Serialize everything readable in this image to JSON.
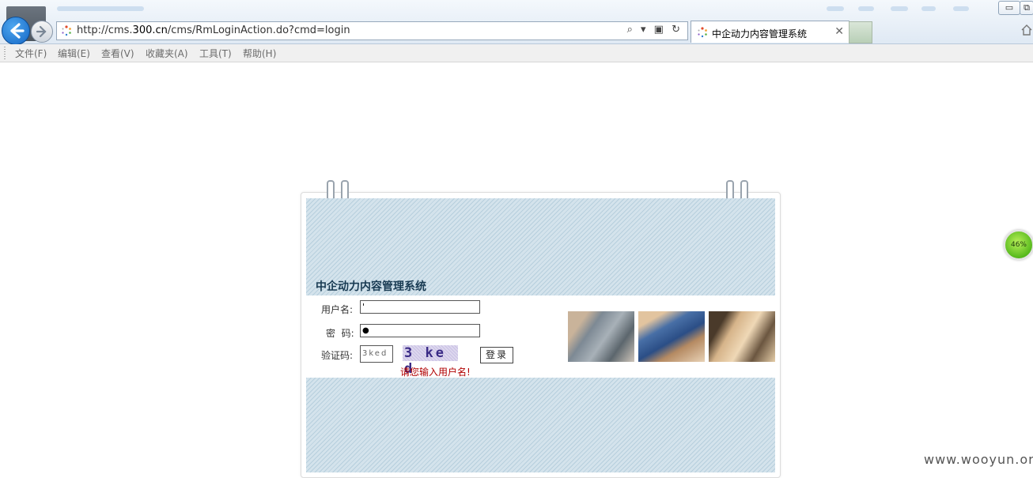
{
  "browser": {
    "url_prefix": "http://cms.",
    "url_domain": "300.cn",
    "url_path": "/cms/RmLoginAction.do?cmd=login",
    "address_controls": "⌕ ▾ ▣ ↻",
    "tab_title": "中企动力内容管理系统",
    "tab_close": "✕",
    "window_min": "▭",
    "window_restore": "⧉"
  },
  "menu": [
    {
      "label": "文件(F)"
    },
    {
      "label": "编辑(E)"
    },
    {
      "label": "查看(V)"
    },
    {
      "label": "收藏夹(A)"
    },
    {
      "label": "工具(T)"
    },
    {
      "label": "帮助(H)"
    }
  ],
  "login": {
    "system_title": "中企动力内容管理系统",
    "username_label": "用户名:",
    "username_value": "'",
    "password_label": "密  码:",
    "password_value": "●",
    "captcha_label": "验证码:",
    "captcha_input_value": "3ked",
    "captcha_image_text": "3 ke d",
    "login_button": "登录",
    "error_message": "请您输入用户名!"
  },
  "widgets": {
    "progress_text": "46%",
    "progress_value": 46
  },
  "watermark": "www.wooyun.org",
  "colors": {
    "accent_blue": "#1466c4",
    "error_red": "#b00000",
    "title_navy": "#183a52",
    "hatch_bg": "#d4e3ec"
  }
}
